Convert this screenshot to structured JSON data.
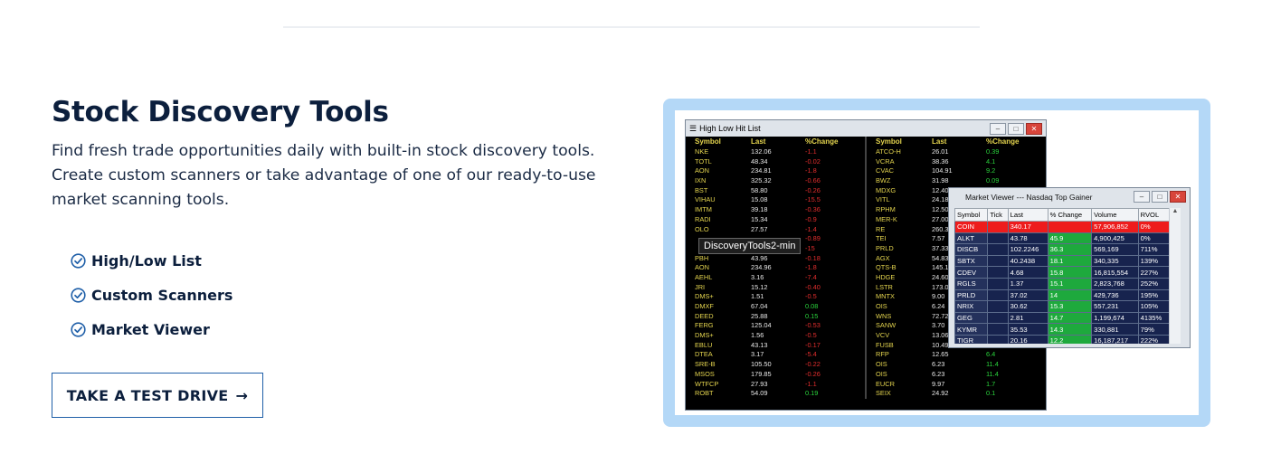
{
  "section": {
    "title": "Stock Discovery Tools",
    "description": "Find fresh trade opportunities daily with built-in stock discovery tools. Create custom scanners or take advantage of one of our ready-to-use market scanning tools.",
    "features": [
      "High/Low List",
      "Custom Scanners",
      "Market Viewer"
    ],
    "cta_label": "TAKE A TEST DRIVE",
    "cta_arrow": "→"
  },
  "colors": {
    "accent": "#1f5fa8",
    "check": "#1f5fa8",
    "frame": "#b4d8f7"
  },
  "screenshot": {
    "tooltip": "DiscoveryTools2-min",
    "high_low": {
      "title": "High Low Hit List",
      "headers": [
        "Symbol",
        "Last",
        "%Change"
      ],
      "left_rows": [
        [
          "NKE",
          "132.06",
          "-1.1"
        ],
        [
          "TOTL",
          "48.34",
          "-0.02"
        ],
        [
          "AON",
          "234.81",
          "-1.8"
        ],
        [
          "IXN",
          "325.32",
          "-0.66"
        ],
        [
          "BST",
          "58.80",
          "-0.26"
        ],
        [
          "VIHAU",
          "15.08",
          "-15.5"
        ],
        [
          "IMTM",
          "39.18",
          "-0.36"
        ],
        [
          "RADI",
          "15.34",
          "-0.9"
        ],
        [
          "OLO",
          "27.57",
          "-1.4"
        ],
        [
          "",
          "",
          "-0.89"
        ],
        [
          "",
          "",
          "-15"
        ],
        [
          "PBH",
          "43.96",
          "-0.18"
        ],
        [
          "AON",
          "234.96",
          "-1.8"
        ],
        [
          "AEHL",
          "3.16",
          "-7.4"
        ],
        [
          "JRI",
          "15.12",
          "-0.40"
        ],
        [
          "DMS+",
          "1.51",
          "-0.5"
        ],
        [
          "DMXF",
          "67.04",
          "0.08"
        ],
        [
          "DEED",
          "25.88",
          "0.15"
        ],
        [
          "FERG",
          "125.04",
          "-0.53"
        ],
        [
          "DMS+",
          "1.56",
          "-0.5"
        ],
        [
          "EBLU",
          "43.13",
          "-0.17"
        ],
        [
          "DTEA",
          "3.17",
          "-5.4"
        ],
        [
          "SRE-B",
          "105.50",
          "-0.22"
        ],
        [
          "MSOS",
          "179.85",
          "-0.26"
        ],
        [
          "WTFCP",
          "27.93",
          "-1.1"
        ],
        [
          "ROBT",
          "54.09",
          "0.19"
        ]
      ],
      "right_rows": [
        [
          "ATCO-H",
          "26.01",
          "0.39"
        ],
        [
          "VCRA",
          "38.36",
          "4.1"
        ],
        [
          "CVAC",
          "104.91",
          "9.2"
        ],
        [
          "BWZ",
          "31.98",
          "0.09"
        ],
        [
          "MDXG",
          "12.40",
          ""
        ],
        [
          "VITL",
          "24.18",
          ""
        ],
        [
          "RPHM",
          "12.50",
          ""
        ],
        [
          "MER-K",
          "27.00",
          ""
        ],
        [
          "RE",
          "260.3",
          ""
        ],
        [
          "TEI",
          "7.57",
          ""
        ],
        [
          "PRLD",
          "37.33",
          ""
        ],
        [
          "AGX",
          "54.83",
          ""
        ],
        [
          "QTS-B",
          "145.1",
          ""
        ],
        [
          "HDGE",
          "24.60",
          ""
        ],
        [
          "LSTR",
          "173.0",
          ""
        ],
        [
          "MNTX",
          "9.00",
          ""
        ],
        [
          "OIS",
          "6.24",
          ""
        ],
        [
          "WNS",
          "72.72",
          ""
        ],
        [
          "SANW",
          "3.70",
          ""
        ],
        [
          "VCV",
          "13.06",
          ""
        ],
        [
          "FUSB",
          "10.49",
          ""
        ],
        [
          "RFP",
          "12.65",
          "6.4"
        ],
        [
          "OIS",
          "6.23",
          "11.4"
        ],
        [
          "OIS",
          "6.23",
          "11.4"
        ],
        [
          "EUCR",
          "9.97",
          "1.7"
        ],
        [
          "SEIX",
          "24.92",
          "0.1"
        ]
      ]
    },
    "market_viewer": {
      "title": "Market Viewer --- Nasdaq Top Gainer",
      "headers": [
        "Symbol",
        "Tick",
        "Last",
        "% Change",
        "Volume",
        "RVOL"
      ],
      "rows": [
        [
          "COIN",
          "",
          "340.17",
          "",
          "57,906,852",
          "0%"
        ],
        [
          "ALKT",
          "",
          "43.78",
          "45.9",
          "4,900,425",
          "0%"
        ],
        [
          "DISCB",
          "",
          "102.2246",
          "36.3",
          "569,169",
          "711%"
        ],
        [
          "SBTX",
          "",
          "40.2438",
          "18.1",
          "340,335",
          "139%"
        ],
        [
          "CDEV",
          "",
          "4.68",
          "15.8",
          "16,815,554",
          "227%"
        ],
        [
          "RGLS",
          "",
          "1.37",
          "15.1",
          "2,823,768",
          "252%"
        ],
        [
          "PRLD",
          "",
          "37.02",
          "14",
          "429,736",
          "195%"
        ],
        [
          "NRIX",
          "",
          "30.62",
          "15.3",
          "557,231",
          "105%"
        ],
        [
          "GEG",
          "",
          "2.81",
          "14.7",
          "1,199,674",
          "4135%"
        ],
        [
          "KYMR",
          "",
          "35.53",
          "14.3",
          "330,881",
          "79%"
        ],
        [
          "TIGR",
          "",
          "20.16",
          "12.2",
          "16,187,217",
          "222%"
        ]
      ]
    }
  }
}
